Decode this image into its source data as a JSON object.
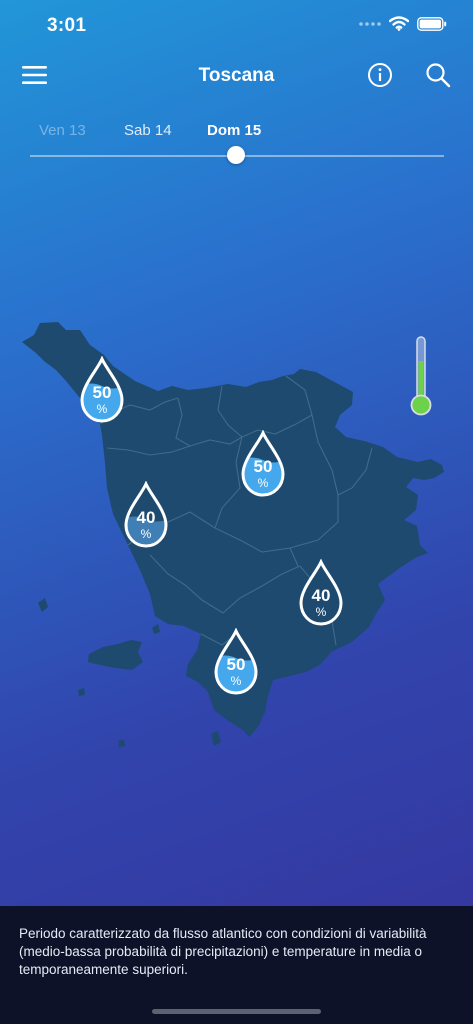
{
  "status_bar": {
    "time": "3:01"
  },
  "header": {
    "title": "Toscana",
    "icons": [
      "menu-icon",
      "info-icon",
      "search-icon"
    ]
  },
  "days": {
    "tabs": [
      {
        "label": "Ven 13",
        "state": "past"
      },
      {
        "label": "Sab 14",
        "state": "normal"
      },
      {
        "label": "Dom 15",
        "state": "selected"
      }
    ]
  },
  "markers": [
    {
      "value": "50",
      "unit": "%",
      "fill_level": 0.5
    },
    {
      "value": "50",
      "unit": "%",
      "fill_level": 0.5
    },
    {
      "value": "40",
      "unit": "%",
      "fill_level": 0.4
    },
    {
      "value": "40",
      "unit": "%",
      "fill_level": 0.4
    },
    {
      "value": "50",
      "unit": "%",
      "fill_level": 0.5
    }
  ],
  "thermometer": {
    "level": 0.6
  },
  "description": {
    "text": "Periodo caratterizzato da flusso atlantico con condizioni di variabilità (medio-bassa probabilità di precipitazioni) e temperature in media o temporaneamente superiori."
  },
  "colors": {
    "map_fill": "#1d4a6e",
    "region_border": "#3e6c8d",
    "drop_fill": "#45a8ec",
    "thermo_green": "#6cd24a",
    "footer_bg": "#0e1229"
  }
}
